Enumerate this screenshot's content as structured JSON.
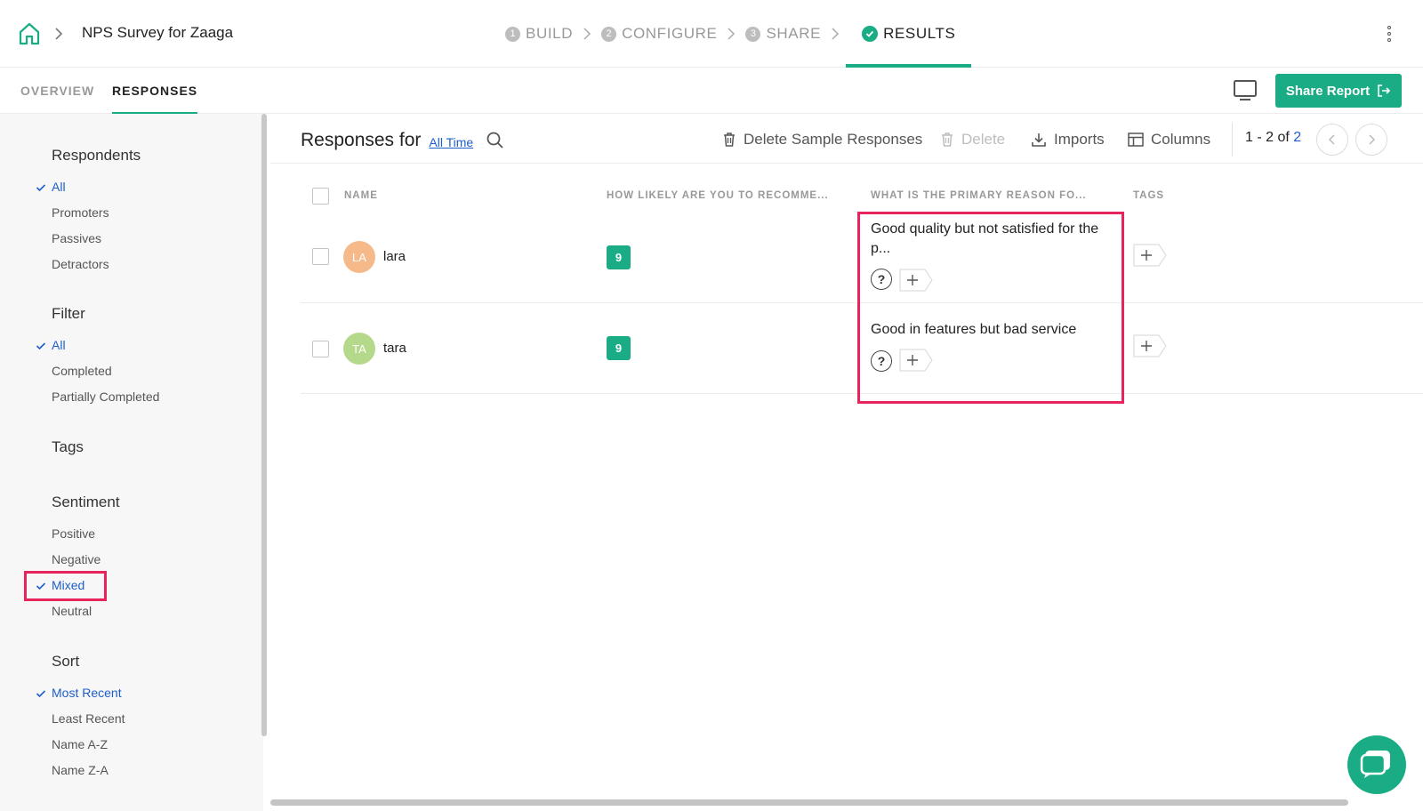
{
  "topbar": {
    "survey_title": "NPS Survey for Zaaga",
    "steps": [
      {
        "num": "1",
        "label": "BUILD"
      },
      {
        "num": "2",
        "label": "CONFIGURE"
      },
      {
        "num": "3",
        "label": "SHARE"
      },
      {
        "label": "RESULTS",
        "active": true
      }
    ]
  },
  "tabs": {
    "overview": "OVERVIEW",
    "responses": "RESPONSES",
    "share_report": "Share Report"
  },
  "sidebar": {
    "respondents": {
      "heading": "Respondents",
      "items": [
        "All",
        "Promoters",
        "Passives",
        "Detractors"
      ],
      "selected": "All"
    },
    "filter": {
      "heading": "Filter",
      "items": [
        "All",
        "Completed",
        "Partially Completed"
      ],
      "selected": "All"
    },
    "tags": {
      "heading": "Tags"
    },
    "sentiment": {
      "heading": "Sentiment",
      "items": [
        "Positive",
        "Negative",
        "Mixed",
        "Neutral"
      ],
      "selected": "Mixed"
    },
    "sort": {
      "heading": "Sort",
      "items": [
        "Most Recent",
        "Least Recent",
        "Name A-Z",
        "Name Z-A"
      ],
      "selected": "Most Recent"
    }
  },
  "main": {
    "title": "Responses for",
    "time_range": "All Time",
    "toolbar": {
      "delete_sample": "Delete Sample Responses",
      "delete": "Delete",
      "imports": "Imports",
      "columns": "Columns"
    },
    "pager": {
      "range": "1 - 2",
      "of": "of",
      "total": "2"
    }
  },
  "table": {
    "columns": [
      "NAME",
      "HOW LIKELY ARE YOU TO RECOMME...",
      "WHAT IS THE PRIMARY REASON FO...",
      "TAGS"
    ],
    "rows": [
      {
        "initials": "LA",
        "name": "lara",
        "score": "9",
        "reason": "Good quality but not satisfied for the p...",
        "avatar_color": "#f6b98a"
      },
      {
        "initials": "TA",
        "name": "tara",
        "score": "9",
        "reason": "Good in features but bad service",
        "avatar_color": "#b5d98a"
      }
    ],
    "question_glyph": "?"
  },
  "colors": {
    "accent": "#1aad85",
    "link": "#1d5fc9",
    "highlight": "#e8245c"
  }
}
